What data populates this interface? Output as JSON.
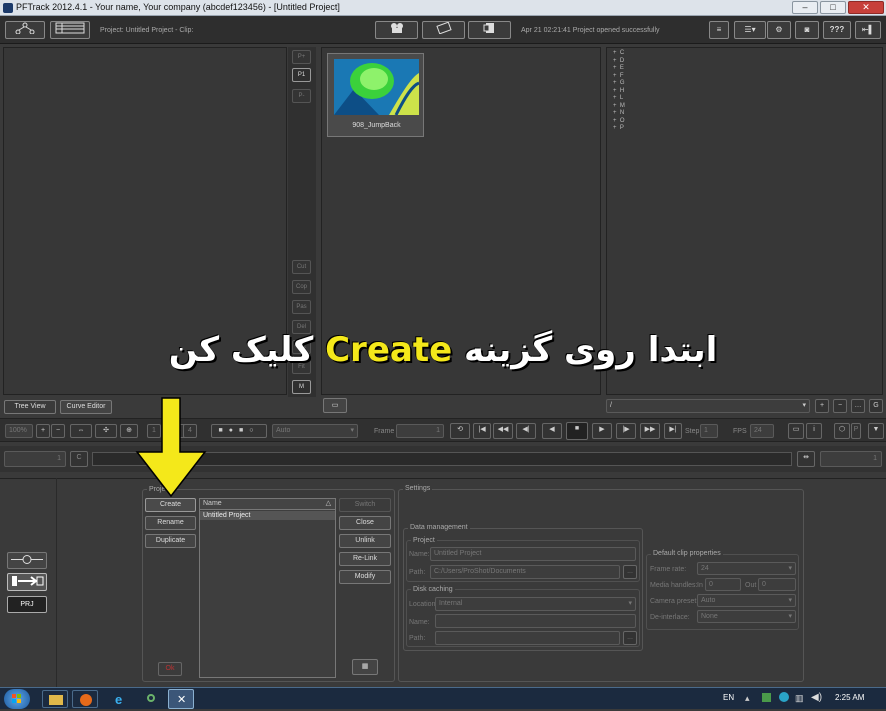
{
  "window": {
    "title": "PFTrack 2012.4.1 - Your name, Your company (abcdef123456) - [Untitled Project]"
  },
  "toolbar": {
    "project_info": "Project: Untitled Project - Clip:",
    "status": "Apr 21 02:21:41 Project opened successfully",
    "help_label": "???"
  },
  "left_panel": {
    "side_buttons": [
      "P+",
      "P1",
      "P-"
    ],
    "edit_buttons": [
      "Cut",
      "Cop",
      "Pas",
      "Del",
      "Ext",
      "Fit",
      "M"
    ],
    "tabs": [
      "Tree View",
      "Curve Editor"
    ]
  },
  "clip": {
    "name": "908_JumpBack"
  },
  "right_list": [
    "C",
    "D",
    "E",
    "F",
    "G",
    "H",
    "L",
    "M",
    "N",
    "O",
    "P"
  ],
  "right_dropdown": "/",
  "playback": {
    "zoom": "100%",
    "mode": "Auto",
    "frame_label": "Frame",
    "frame": "1",
    "step_label": "Step",
    "step": "1",
    "fps_label": "FPS",
    "fps": "24",
    "num_buttons": [
      "1",
      "2",
      "3",
      "4"
    ]
  },
  "timeline": {
    "start": "1",
    "end": "1",
    "c_label": "C"
  },
  "project": {
    "group_label": "Project",
    "buttons": [
      "Create",
      "Rename",
      "Duplicate"
    ],
    "ok_label": "Ok",
    "list_header": "Name",
    "list_items": [
      "Untitled Project"
    ],
    "actions": [
      "Switch",
      "Close",
      "Unlink",
      "Re-Link",
      "Modify"
    ]
  },
  "settings": {
    "title": "Settings",
    "data_management": "Data management",
    "project_group": "Project",
    "name_label": "Name:",
    "name_value": "Untitled Project",
    "path_label": "Path:",
    "path_value": "C:/Users/ProShot/Documents",
    "browse": "...",
    "disk_caching": "Disk caching",
    "location_label": "Location:",
    "location_value": "Internal",
    "dc_name_label": "Name:",
    "dc_path_label": "Path:",
    "clip_props": "Default clip properties",
    "frame_rate_label": "Frame rate:",
    "frame_rate_value": "24",
    "media_handles_label": "Media handles:",
    "in_label": "In",
    "in_value": "0",
    "out_label": "Out",
    "out_value": "0",
    "camera_preset_label": "Camera preset:",
    "camera_preset_value": "Auto",
    "deinterlace_label": "De-interlace:",
    "deinterlace_value": "None"
  },
  "left_icons": {
    "prj_label": "PRJ"
  },
  "overlay": {
    "before": "ابتدا روی گزینه",
    "highlight": "Create",
    "after": "کلیک کن"
  },
  "taskbar": {
    "lang": "EN",
    "time": "2:25 AM"
  },
  "colors": {
    "arrow": "#f4e81a",
    "highlight_text": "#f4e81a",
    "taskbar": "#1b2a3f"
  }
}
